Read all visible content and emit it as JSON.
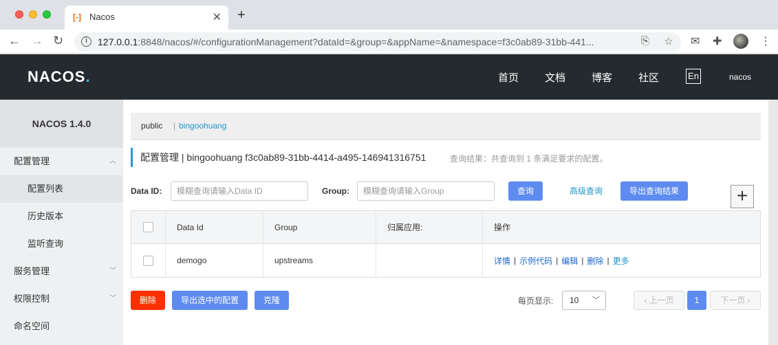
{
  "browser": {
    "tab_title": "Nacos",
    "tab_favicon": "[-]",
    "url_host": "127.0.0.1",
    "url_rest": ":8848/nacos/#/configurationManagement?dataId=&group=&appName=&namespace=f3c0ab89-31bb-441..."
  },
  "header": {
    "logo": "NACOS",
    "logo_dot": ".",
    "nav": [
      "首页",
      "文档",
      "博客",
      "社区"
    ],
    "lang": "En",
    "user": "nacos"
  },
  "sidebar": {
    "title": "NACOS 1.4.0",
    "items": [
      {
        "label": "配置管理"
      },
      {
        "label": "配置列表"
      },
      {
        "label": "历史版本"
      },
      {
        "label": "监听查询"
      },
      {
        "label": "服务管理"
      },
      {
        "label": "权限控制"
      },
      {
        "label": "命名空间"
      }
    ]
  },
  "namespace": {
    "public": "public",
    "separator": "|",
    "current": "bingoohuang"
  },
  "page": {
    "title": "配置管理 | bingoohuang f3c0ab89-31bb-4414-a495-146941316751",
    "query_result": "查询结果：共查询到 1 条满足要求的配置。"
  },
  "filters": {
    "dataid_label": "Data ID:",
    "dataid_placeholder": "模糊查询请输入Data ID",
    "group_label": "Group:",
    "group_placeholder": "模糊查询请输入Group",
    "search_btn": "查询",
    "advanced_btn": "高级查询",
    "export_btn": "导出查询结果",
    "add_btn": "+"
  },
  "table": {
    "headers": [
      "Data Id",
      "Group",
      "归属应用:",
      "操作"
    ],
    "rows": [
      {
        "data_id": "demogo",
        "group": "upstreams",
        "app": "",
        "ops": [
          "详情",
          "示例代码",
          "编辑",
          "删除",
          "更多"
        ]
      }
    ]
  },
  "footer": {
    "delete_btn": "删除",
    "export_selected_btn": "导出选中的配置",
    "clone_btn": "克隆",
    "page_size_label": "每页显示:",
    "page_size": "10",
    "prev": "上一页",
    "page": "1",
    "next": "下一页"
  },
  "colors": {
    "primary": "#5e8bef",
    "danger": "#ff3000",
    "header_bg": "#252a2f",
    "link": "#1f96c6"
  }
}
